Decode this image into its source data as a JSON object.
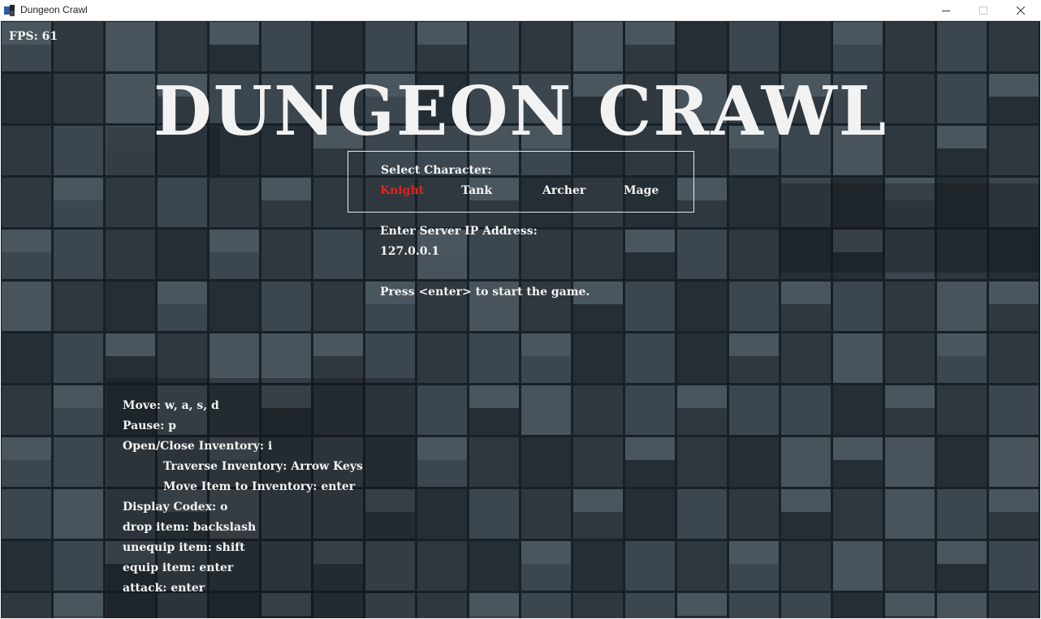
{
  "window": {
    "title": "Dungeon Crawl",
    "controls": {
      "minimize": "minimize-icon",
      "maximize": "maximize-icon",
      "close": "close-icon"
    }
  },
  "hud": {
    "fps": "FPS: 61"
  },
  "menu": {
    "title": "DUNGEON CRAWL",
    "select_label": "Select Character:",
    "characters": [
      "Knight",
      "Tank",
      "Archer",
      "Mage"
    ],
    "selected_character": "Knight",
    "selected_color": "#e8201c",
    "ip_label": "Enter Server IP Address:",
    "ip_value": "127.0.0.1",
    "start_hint": "Press <enter> to start the game."
  },
  "controls_help": [
    "Move: w, a, s, d",
    "Pause: p",
    "Open/Close Inventory: i",
    "Traverse Inventory: Arrow Keys",
    "Move Item to Inventory: enter",
    "Display Codex: o",
    "drop item: backslash",
    "unequip item: shift",
    "equip item: enter",
    "attack: enter"
  ],
  "colors": {
    "floor_dark": "#222a31",
    "floor_tile": "#3a444c",
    "wall_tile": "#5d6a73",
    "text": "#f4f4f4"
  }
}
